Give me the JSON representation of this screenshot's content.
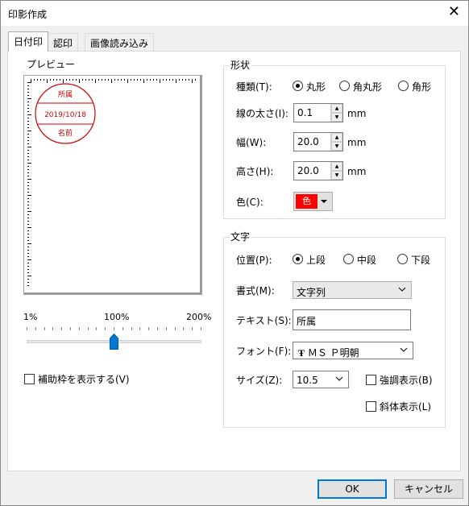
{
  "window": {
    "title": "印影作成",
    "close_glyph": "✕"
  },
  "tabs": [
    {
      "label": "日付印",
      "active": true
    },
    {
      "label": "認印",
      "active": false
    },
    {
      "label": "画像読み込み",
      "active": false
    }
  ],
  "preview": {
    "group_title": "プレビュー",
    "stamp": {
      "top_text": "所属",
      "middle_text": "2019/10/18",
      "bottom_text": "名前",
      "color": "#cc0000"
    },
    "zoom": {
      "min_label": "1%",
      "mid_label": "100%",
      "max_label": "200%",
      "value_percent": 100
    },
    "show_guide_label": "補助枠を表示する(V)",
    "show_guide_checked": false
  },
  "shape": {
    "group_title": "形状",
    "type_label": "種類(T):",
    "type_options": [
      "丸形",
      "角丸形",
      "角形"
    ],
    "type_selected": 0,
    "line_width_label": "線の太さ(I):",
    "line_width_value": "0.1",
    "width_label": "幅(W):",
    "width_value": "20.0",
    "height_label": "高さ(H):",
    "height_value": "20.0",
    "unit": "mm",
    "color_label": "色(C):",
    "color_swatch_text": "色",
    "color_value": "#ff0000"
  },
  "text": {
    "group_title": "文字",
    "position_label": "位置(P):",
    "position_options": [
      "上段",
      "中段",
      "下段"
    ],
    "position_selected": 0,
    "format_label": "書式(M):",
    "format_value": "文字列",
    "text_label": "テキスト(S):",
    "text_value": "所属",
    "font_label": "フォント(F):",
    "font_value": "ＭＳ Ｐ明朝",
    "size_label": "サイズ(Z):",
    "size_value": "10.5",
    "bold_label": "強調表示(B)",
    "bold_checked": false,
    "italic_label": "斜体表示(L)",
    "italic_checked": false
  },
  "footer": {
    "ok_label": "OK",
    "cancel_label": "キャンセル"
  }
}
